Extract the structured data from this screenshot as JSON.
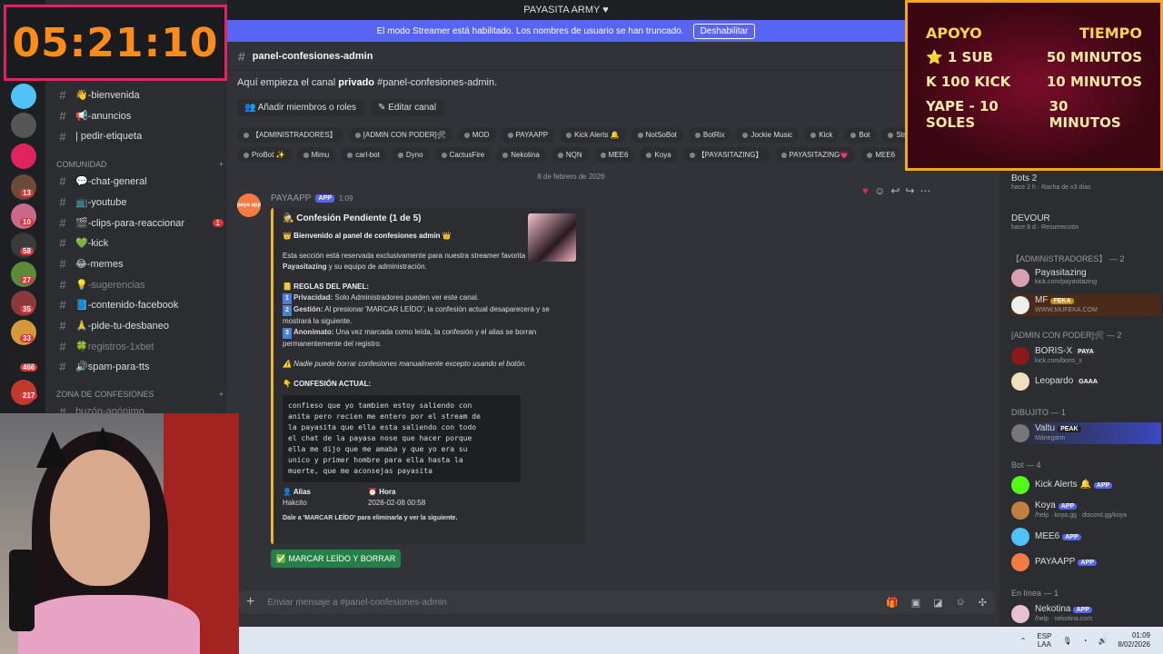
{
  "window": {
    "title": "PAYASITA ARMY ♥"
  },
  "streamer_bar": {
    "text": "El modo Streamer está habilitado. Los nombres de usuario se han truncado.",
    "button": "Deshabilitar"
  },
  "timer": {
    "value": "05:21:10"
  },
  "servers": {
    "badges": [
      "222",
      "2",
      "13",
      "10",
      "58",
      "27",
      "35",
      "33",
      "466",
      "217"
    ]
  },
  "sidebar": {
    "top_items": [
      {
        "label": "👋-bienvenida"
      },
      {
        "label": "📢-anuncios"
      },
      {
        "label": "| pedir-etiqueta"
      }
    ],
    "categories": {
      "comunidad": "COMUNIDAD",
      "zona": "ZONA DE CONFESIONES"
    },
    "comunidad_items": [
      {
        "label": "💬-chat-general",
        "muted": false,
        "unread": ""
      },
      {
        "label": "📺-youtube",
        "muted": false,
        "unread": ""
      },
      {
        "label": "🎬-clips-para-reaccionar",
        "muted": false,
        "unread": "1"
      },
      {
        "label": "💚-kick",
        "muted": false,
        "unread": ""
      },
      {
        "label": "😂-memes",
        "muted": false,
        "unread": ""
      },
      {
        "label": "💡-sugerencias",
        "muted": true,
        "unread": ""
      },
      {
        "label": "📘-contenido-facebook",
        "muted": false,
        "unread": ""
      },
      {
        "label": "🙏-pide-tu-desbaneo",
        "muted": false,
        "unread": ""
      },
      {
        "label": "🍀registros-1xbet",
        "muted": true,
        "unread": ""
      },
      {
        "label": "🔊spam-para-tts",
        "muted": false,
        "unread": ""
      }
    ],
    "zona_items": [
      {
        "label": "buzón-anónimo"
      }
    ]
  },
  "channel": {
    "name": "panel-confesiones-admin",
    "intro_prefix": "Aquí empieza el canal ",
    "intro_bold": "privado",
    "intro_suffix": " #panel-confesiones-admin.",
    "actions": {
      "add_members": "Añadir miembros o roles",
      "edit_channel": "Editar canal"
    }
  },
  "roles_row1": [
    "【ADMINISTRADORES】",
    "[ADMIN CON PODER]🛠",
    "MOD",
    "PAYAAPP",
    "Kick Alerts 🔔",
    "NotSoBot",
    "BotRix",
    "Jockie Music",
    "Kick",
    "Bot",
    "Stream"
  ],
  "roles_row2": [
    "ProBot ✨",
    "Mimu",
    "carl-bot",
    "Dyno",
    "CactusFire",
    "Nekotina",
    "NQN",
    "MEE6",
    "Koya",
    "【PAYASITAZING】",
    "PAYASITAZING💗",
    "MEE6",
    "Koya"
  ],
  "date_separator": "8 de febrero de 2026",
  "message": {
    "author": "PAYAAPP",
    "tag": "APP",
    "time": "1:09",
    "avatar_text": "paya app",
    "embed": {
      "title": "🕵 Confesión Pendiente (1 de 5)",
      "welcome": "👑 Bienvenido al panel de confesiones admin 👑",
      "desc_prefix": "Esta sección está reservada exclusivamente para nuestra streamer favorita ",
      "desc_bold": "la Payasitazing",
      "desc_suffix": " y su equipo de administración.",
      "rules_title": "📒 REGLAS DEL PANEL:",
      "rules": [
        {
          "num": "1",
          "bold": "Privacidad:",
          "text": " Solo Administradores pueden ver este canal."
        },
        {
          "num": "2",
          "bold": "Gestión:",
          "text": " Al presionar 'MARCAR LEÍDO', la confesión actual desaparecerá y se mostrará la siguiente."
        },
        {
          "num": "3",
          "bold": "Anonimato:",
          "text": " Una vez marcada como leída, la confesión y el alias se borran permanentemente del registro."
        }
      ],
      "warning": "⚠️ Nadie puede borrar confesiones manualmente excepto usando el botón.",
      "confession_title": "👇 CONFESIÓN ACTUAL:",
      "confession": "confieso que yo tambien estoy saliendo con\nanita pero recien me entero por el stream de\nla payasita que ella esta saliendo con todo\nel chat de la payasa nose que hacer porque\nella me dijo que me amaba y que yo era su\nunico y primer hombre para ella hasta la\nmuerte, que me aconsejas payasita",
      "alias_label": "👤 Alias",
      "alias_value": "Hakcito",
      "hora_label": "⏰ Hora",
      "hora_value": "2026-02-08 00:58",
      "footer": "Dale a 'MARCAR LEÍDO' para eliminarla y ver la siguiente."
    },
    "button": "✅ MARCAR LEÍDO Y BORRAR"
  },
  "composer": {
    "placeholder": "Enviar mensaje a #panel-confesiones-admin"
  },
  "subs_panel": {
    "headers": [
      "APOYO",
      "TIEMPO"
    ],
    "rows": [
      {
        "left": "⭐ 1 SUB",
        "right": "50 MINUTOS"
      },
      {
        "left": "K 100 KICK",
        "right": "10 MINUTOS"
      },
      {
        "left": "YAPE - 10 SOLES",
        "right": "30 MINUTOS"
      }
    ]
  },
  "members": {
    "top": [
      {
        "name": "Bots 2",
        "sub": "hace 2 h · Racha de x3 días"
      },
      {
        "name": "DEVOUR",
        "sub": "hace 8 d · Resurrección"
      }
    ],
    "groups": [
      {
        "title": "【ADMINISTRADORES】 — 2",
        "items": [
          {
            "name": "Payasitazing",
            "sub": "kick.com/payasitazing",
            "tag": ""
          },
          {
            "name": "MF",
            "sub": "WWW.MUFEKA.COM",
            "tag": "FEKA"
          }
        ]
      },
      {
        "title": "[ADMIN CON PODER]🛠 — 2",
        "items": [
          {
            "name": "BORIS-X",
            "sub": "kick.com/boris_x",
            "tag": "PAYA"
          },
          {
            "name": "Leopardo",
            "sub": "",
            "tag": "GAAA"
          }
        ]
      },
      {
        "title": "DIBUJITO — 1",
        "items": [
          {
            "name": "Valtu",
            "sub": "Mánegarm",
            "tag": "PEAK"
          }
        ]
      },
      {
        "title": "Bot — 4",
        "items": [
          {
            "name": "Kick Alerts 🔔",
            "sub": "",
            "tag": "APP"
          },
          {
            "name": "Koya",
            "sub": "/help · koya.gg · discord.gg/koya",
            "tag": "APP"
          },
          {
            "name": "MEE6",
            "sub": "",
            "tag": "APP"
          },
          {
            "name": "PAYAAPP",
            "sub": "",
            "tag": "APP"
          }
        ]
      },
      {
        "title": "En línea — 1",
        "items": [
          {
            "name": "Nekotina",
            "sub": "/help · nekotina.com",
            "tag": "APP"
          }
        ]
      }
    ]
  },
  "taskbar": {
    "lang1": "ESP",
    "lang2": "LAA",
    "time": "01:09",
    "date": "8/02/2026"
  },
  "colors": {
    "accent": "#5865f2",
    "embed_border": "#f0b232",
    "button_green": "#248046",
    "timer_border": "#e0245e",
    "timer_text": "#ff8c1a"
  }
}
